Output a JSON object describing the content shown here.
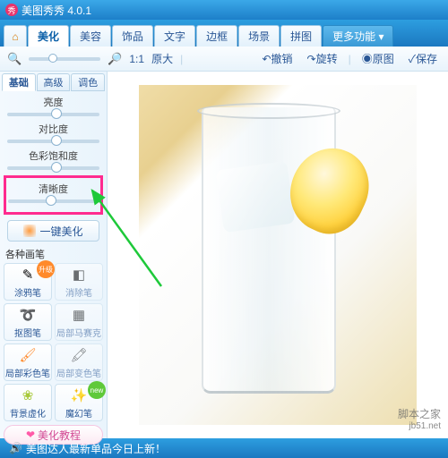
{
  "app": {
    "title": "美图秀秀 4.0.1"
  },
  "tabs": {
    "beautify": "美化",
    "face": "美容",
    "accessory": "饰品",
    "text": "文字",
    "frame": "边框",
    "scene": "场景",
    "collage": "拼图",
    "more": "更多功能 ▾"
  },
  "toolbar": {
    "ratio": "1:1",
    "zoom_label": "原大",
    "undo": "撤销",
    "redo": "旋转",
    "reset": "原图",
    "save": "保存"
  },
  "subtabs": {
    "basic": "基础",
    "advanced": "高级",
    "tone": "调色"
  },
  "sliders": {
    "brightness": "亮度",
    "contrast": "对比度",
    "saturation": "色彩饱和度",
    "sharpness": "清晰度"
  },
  "onekey": "一键美化",
  "brush_section": "各种画笔",
  "brushes": {
    "doodle": "涂鸦笔",
    "erase": "消除笔",
    "cutout": "抠图笔",
    "mosaic": "局部马赛克",
    "color": "局部彩色笔",
    "recolor": "局部变色笔",
    "blur": "背景虚化",
    "magic": "魔幻笔"
  },
  "badges": {
    "upgrade": "升级",
    "new": "new"
  },
  "tutorial": "美化教程",
  "status": {
    "news": "美图达人最新单品今日上新！"
  },
  "watermark": {
    "cn": "脚本之家",
    "en": "jb51.net"
  },
  "colors": {
    "accent": "#1d7fc9",
    "highlight": "#ff2b8f"
  }
}
